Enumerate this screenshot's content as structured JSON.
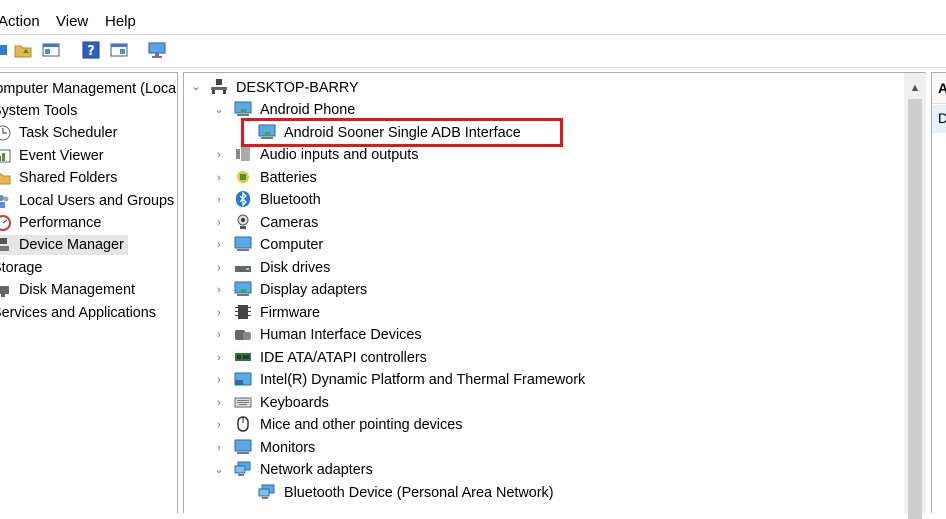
{
  "menu": {
    "action": "Action",
    "view": "View",
    "help": "Help"
  },
  "toolbar": {
    "buttons": [
      "back-icon",
      "up-folder-icon",
      "show-hide-tree-icon",
      "help-icon",
      "properties-icon",
      "monitor-icon"
    ]
  },
  "left_tree": {
    "root": "Computer Management (Local)",
    "system_tools": "System Tools",
    "items": [
      {
        "label": "Task Scheduler",
        "icon": "clock-icon"
      },
      {
        "label": "Event Viewer",
        "icon": "event-viewer-icon"
      },
      {
        "label": "Shared Folders",
        "icon": "shared-folder-icon"
      },
      {
        "label": "Local Users and Groups",
        "icon": "users-icon"
      },
      {
        "label": "Performance",
        "icon": "performance-icon"
      },
      {
        "label": "Device Manager",
        "icon": "device-manager-icon",
        "selected": true
      }
    ],
    "storage": "Storage",
    "disk_management": "Disk Management",
    "services": "Services and Applications"
  },
  "device_tree": {
    "root": "DESKTOP-BARRY",
    "android_phone": "Android Phone",
    "android_child": "Android Sooner Single ADB Interface",
    "categories": [
      "Audio inputs and outputs",
      "Batteries",
      "Bluetooth",
      "Cameras",
      "Computer",
      "Disk drives",
      "Display adapters",
      "Firmware",
      "Human Interface Devices",
      "IDE ATA/ATAPI controllers",
      "Intel(R) Dynamic Platform and Thermal Framework",
      "Keyboards",
      "Mice and other pointing devices",
      "Monitors"
    ],
    "network_adapters": "Network adapters",
    "network_child": "Bluetooth Device (Personal Area Network)"
  },
  "right_pane": {
    "header": "A",
    "row": "D"
  },
  "colors": {
    "highlight": "#e01818",
    "selected": "#e5e5e5",
    "accent": "#1e7bd4"
  }
}
